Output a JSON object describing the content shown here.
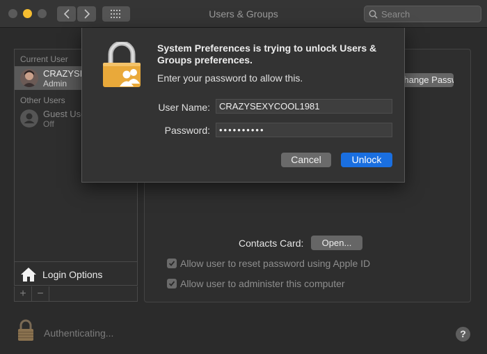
{
  "window": {
    "title": "Users & Groups"
  },
  "toolbar": {
    "search_placeholder": "Search"
  },
  "sidebar": {
    "current_user_header": "Current User",
    "current_user": {
      "name": "CRAZYSEXYCOOL1981",
      "role": "Admin"
    },
    "other_users_header": "Other Users",
    "guest_user": {
      "name": "Guest User",
      "status": "Off"
    },
    "login_options_label": "Login Options",
    "add_symbol": "+",
    "remove_symbol": "−"
  },
  "panel": {
    "change_password_button": "Change Password...",
    "contacts_card_label": "Contacts Card:",
    "open_button": "Open...",
    "checkboxes": [
      {
        "label": "Allow user to reset password using Apple ID",
        "checked": true
      },
      {
        "label": "Allow user to administer this computer",
        "checked": true
      }
    ]
  },
  "footer": {
    "status_text": "Authenticating...",
    "help_symbol": "?"
  },
  "dialog": {
    "title": "System Preferences is trying to unlock Users & Groups preferences.",
    "message": "Enter your password to allow this.",
    "username_label": "User Name:",
    "username_value": "CRAZYSEXYCOOL1981",
    "password_label": "Password:",
    "password_value": "••••••••••",
    "cancel_label": "Cancel",
    "unlock_label": "Unlock"
  },
  "colors": {
    "accent": "#1a6fe0",
    "lock_gold": "#e9a93a",
    "window_bg": "#2b2b2b"
  },
  "icons": [
    "back-icon",
    "forward-icon",
    "grid-icon",
    "search-icon",
    "house-icon",
    "lock-icon",
    "person-icon",
    "users-icon",
    "checkmark-icon"
  ]
}
